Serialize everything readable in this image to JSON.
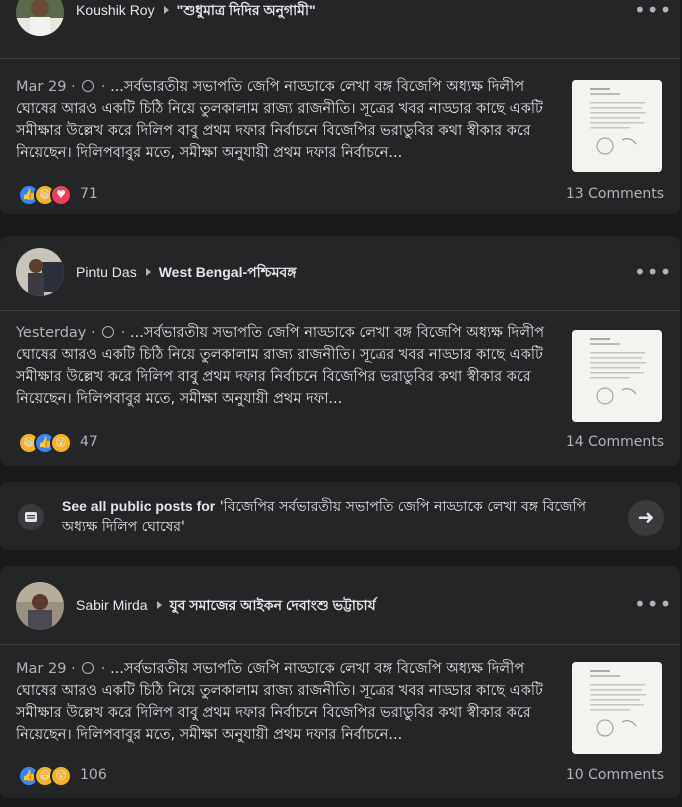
{
  "posts": [
    {
      "author": "Koushik Roy",
      "group": "\"শুধুমাত্র দিদির অনুগামী\"",
      "date": "Mar 29",
      "text": "...সর্বভারতীয় সভাপতি জেপি নাড্ডাকে লেখা বঙ্গ বিজেপি অধ্যক্ষ দিলীপ ঘোষের আরও একটি চিঠি নিয়ে তুলকালাম রাজ্য রাজনীতি। সূত্রের খবর নাড্ডার কাছে একটি সমীক্ষার উল্লেখ করে দিলিপ বাবু প্রথম দফার নির্বাচনে বিজেপির ভরাডুবির কথা স্বীকার করে নিয়েছেন। দিলিপবাবুর মতে, সমীক্ষা অনুযায়ী প্রথম দফার নির্বাচনে...",
      "reaction_icons": [
        "like-icon",
        "haha-icon",
        "love-icon"
      ],
      "reaction_count": "71",
      "comments": "13 Comments"
    },
    {
      "author": "Pintu Das",
      "group": "West Bengal-পশ্চিমবঙ্গ",
      "date": "Yesterday",
      "text": "...সর্বভারতীয় সভাপতি জেপি নাড্ডাকে লেখা বঙ্গ বিজেপি অধ্যক্ষ দিলীপ ঘোষের আরও একটি চিঠি নিয়ে তুলকালাম রাজ্য রাজনীতি। সূত্রের খবর নাড্ডার কাছে একটি সমীক্ষার উল্লেখ করে দিলিপ বাবু প্রথম দফার নির্বাচনে বিজেপির ভরাডুবির কথা স্বীকার করে নিয়েছেন। দিলিপবাবুর মতে, সমীক্ষা অনুযায়ী প্রথম দফা...",
      "reaction_icons": [
        "haha-icon",
        "like-icon",
        "wow-icon"
      ],
      "reaction_count": "47",
      "comments": "14 Comments"
    },
    {
      "author": "Sabir Mirda",
      "group": "যুব সমাজের আইকন দেবাংশু ভট্টাচার্য",
      "date": "Mar 29",
      "text": "...সর্বভারতীয় সভাপতি জেপি নাড্ডাকে লেখা বঙ্গ বিজেপি অধ্যক্ষ দিলীপ ঘোষের আরও একটি চিঠি নিয়ে তুলকালাম রাজ্য রাজনীতি। সূত্রের খবর নাড্ডার কাছে একটি সমীক্ষার উল্লেখ করে দিলিপ বাবু প্রথম দফার নির্বাচনে বিজেপির ভরাডুবির কথা স্বীকার করে নিয়েছেন। দিলিপবাবুর মতে, সমীক্ষা অনুযায়ী প্রথম দফার নির্বাচনে...",
      "reaction_icons": [
        "like-icon",
        "haha-icon",
        "wow-icon"
      ],
      "reaction_count": "106",
      "comments": "10 Comments"
    }
  ],
  "see_all": {
    "prefix": "See all public posts for",
    "query": "'বিজেপির সর্বভারতীয় সভাপতি জেপি নাড্ডাকে লেখা বঙ্গ বিজেপি অধ্যক্ষ দিলিপ ঘোষের'"
  },
  "colors": {
    "background": "#18191a",
    "card": "#242526",
    "text": "#e4e6eb",
    "secondary": "#b0b3b8",
    "like": "#2d88ff",
    "love": "#f33e58",
    "haha": "#f7b125"
  }
}
